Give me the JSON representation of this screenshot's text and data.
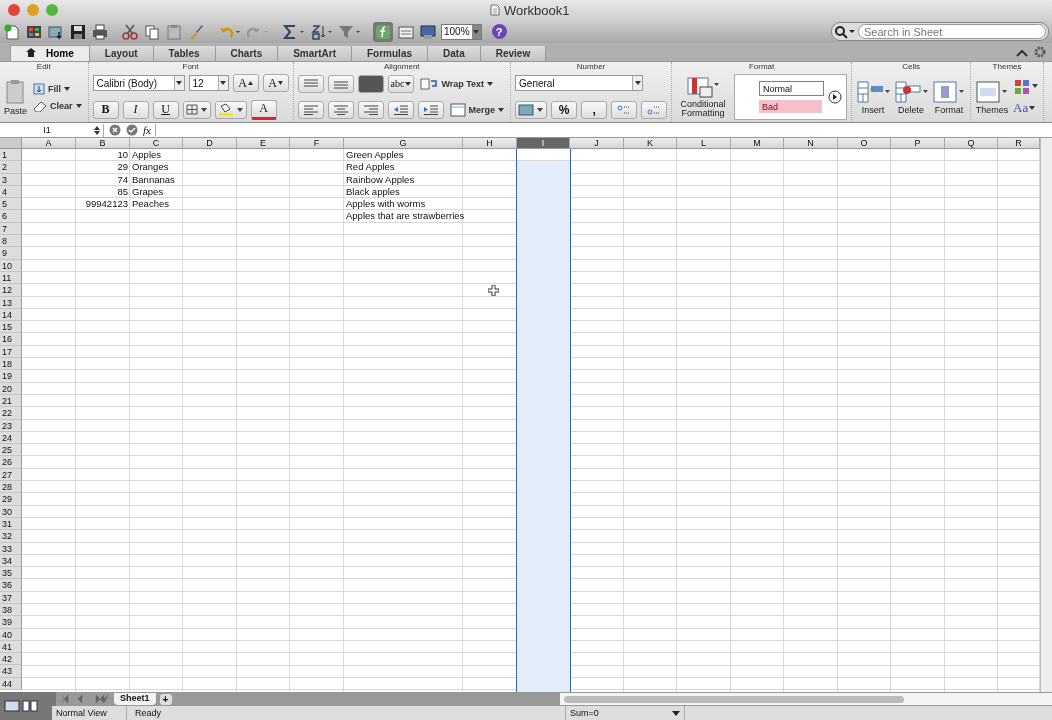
{
  "window": {
    "title": "Workbook1"
  },
  "toolbar": {
    "zoom": "100%",
    "help": "?",
    "search": {
      "placeholder": "Search in Sheet"
    }
  },
  "tabs": [
    {
      "label": "Home",
      "selected": true
    },
    {
      "label": "Layout",
      "selected": false
    },
    {
      "label": "Tables",
      "selected": false
    },
    {
      "label": "Charts",
      "selected": false
    },
    {
      "label": "SmartArt",
      "selected": false
    },
    {
      "label": "Formulas",
      "selected": false
    },
    {
      "label": "Data",
      "selected": false
    },
    {
      "label": "Review",
      "selected": false
    }
  ],
  "ribbon": {
    "edit": {
      "title": "Edit",
      "paste": "Paste",
      "fill": "Fill",
      "clear": "Clear"
    },
    "font": {
      "title": "Font",
      "family": "Calibri (Body)",
      "size": "12",
      "grow": "A",
      "shrink": "A",
      "bold": "B",
      "italic": "I",
      "underline": "U",
      "font_color_label": "A"
    },
    "alignment": {
      "title": "Alignment",
      "orientation": "abc",
      "wrap": "Wrap Text",
      "merge": "Merge"
    },
    "number": {
      "title": "Number",
      "format": "General",
      "percent": "%",
      "comma": ","
    },
    "format": {
      "title": "Format",
      "conditional": "Conditional Formatting",
      "styles": [
        {
          "label": "Normal",
          "kind": "normal"
        },
        {
          "label": "Bad",
          "kind": "bad"
        }
      ]
    },
    "cells": {
      "title": "Cells",
      "insert": "Insert",
      "delete": "Delete",
      "format": "Format"
    },
    "themes": {
      "title": "Themes",
      "themes": "Themes",
      "fonts": "Aa"
    }
  },
  "formula_bar": {
    "name_box": "I1",
    "fx": "fx"
  },
  "columns": [
    {
      "label": "A",
      "selected": false
    },
    {
      "label": "B",
      "selected": false,
      "cells": [
        {
          "kind": "number",
          "text": "10"
        },
        {
          "kind": "number",
          "text": "29"
        },
        {
          "kind": "number",
          "text": "74"
        },
        {
          "kind": "number",
          "text": "85"
        },
        {
          "kind": "number",
          "text": "99942123"
        }
      ]
    },
    {
      "label": "C",
      "selected": false,
      "cells": [
        {
          "kind": "text",
          "text": "Apples"
        },
        {
          "kind": "text",
          "text": "Oranges"
        },
        {
          "kind": "text",
          "text": "Bannanas"
        },
        {
          "kind": "text",
          "text": "Grapes"
        },
        {
          "kind": "text",
          "text": "Peaches"
        }
      ]
    },
    {
      "label": "D",
      "selected": false
    },
    {
      "label": "E",
      "selected": false
    },
    {
      "label": "F",
      "selected": false
    },
    {
      "label": "G",
      "selected": false,
      "cells": [
        {
          "kind": "text",
          "text": "Green Apples"
        },
        {
          "kind": "text",
          "text": "Red Apples"
        },
        {
          "kind": "text",
          "text": "Rainbow Apples"
        },
        {
          "kind": "text",
          "text": "Black apples"
        },
        {
          "kind": "text",
          "text": "Apples with worms"
        },
        {
          "kind": "text",
          "text": "Apples that are strawberries"
        }
      ]
    },
    {
      "label": "H",
      "selected": false
    },
    {
      "label": "I",
      "selected": true
    },
    {
      "label": "J",
      "selected": false
    },
    {
      "label": "K",
      "selected": false
    },
    {
      "label": "L",
      "selected": false
    },
    {
      "label": "M",
      "selected": false
    },
    {
      "label": "N",
      "selected": false
    },
    {
      "label": "O",
      "selected": false
    },
    {
      "label": "P",
      "selected": false
    },
    {
      "label": "Q",
      "selected": false
    },
    {
      "label": "R",
      "selected": false
    }
  ],
  "rows": [
    "1",
    "2",
    "3",
    "4",
    "5",
    "6",
    "7",
    "8",
    "9",
    "10",
    "11",
    "12",
    "13",
    "14",
    "15",
    "16",
    "17",
    "18",
    "19",
    "20",
    "21",
    "22",
    "23",
    "24",
    "25",
    "26",
    "27",
    "28",
    "29",
    "30",
    "31",
    "32",
    "33",
    "34",
    "35",
    "36",
    "37",
    "38",
    "39",
    "40",
    "41",
    "42",
    "43",
    "44"
  ],
  "sheet_tabs": [
    {
      "label": "Sheet1",
      "selected": true
    }
  ],
  "add_sheet": "+",
  "status_bar": {
    "view": "Normal View",
    "state": "Ready",
    "sum": "Sum=0"
  }
}
